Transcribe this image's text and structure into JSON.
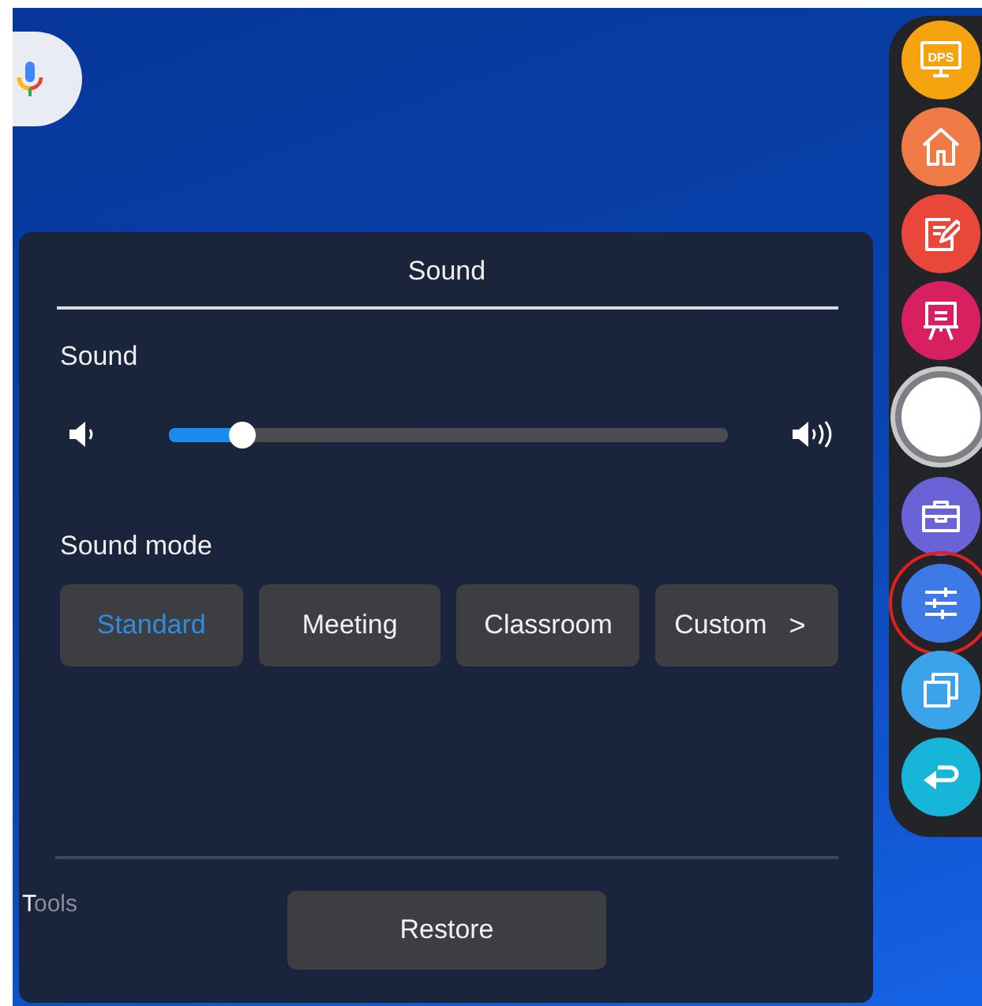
{
  "panel": {
    "title": "Sound",
    "volume": {
      "label": "Sound",
      "level": 0.13
    },
    "sound_mode": {
      "label": "Sound mode",
      "modes": [
        {
          "label": "Standard",
          "selected": true
        },
        {
          "label": "Meeting",
          "selected": false
        },
        {
          "label": "Classroom",
          "selected": false
        },
        {
          "label": "Custom",
          "selected": false
        }
      ],
      "more": ">"
    },
    "restore": "Restore"
  },
  "background_label": "Tools",
  "dock": [
    {
      "kind": "dps",
      "label": "DPS",
      "color": "#f5a30f",
      "selected": false
    },
    {
      "kind": "home",
      "color": "#f07a45",
      "selected": false
    },
    {
      "kind": "note",
      "color": "#e8473a",
      "selected": false
    },
    {
      "kind": "board",
      "color": "#d81f60",
      "selected": false
    },
    {
      "kind": "float",
      "color": "#ffffff",
      "selected": false
    },
    {
      "kind": "toolbox",
      "color": "#6a63d8",
      "selected": false
    },
    {
      "kind": "settings",
      "color": "#3d7ae8",
      "selected": true
    },
    {
      "kind": "windows",
      "color": "#3aa3ea",
      "selected": false
    },
    {
      "kind": "back",
      "color": "#17b5d8",
      "selected": false
    }
  ]
}
